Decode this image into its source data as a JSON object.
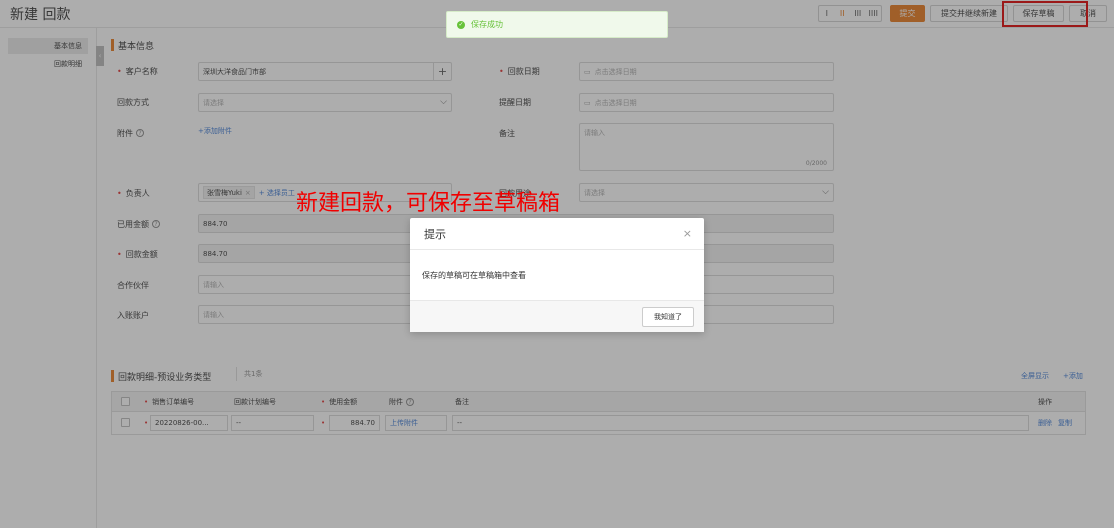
{
  "header": {
    "title": "新建 回款",
    "layout_options": [
      "I",
      "II",
      "III",
      "IIII"
    ],
    "buttons": {
      "submit": "提交",
      "submit_and_new": "提交并继续新建",
      "save_draft": "保存草稿",
      "cancel": "取消"
    }
  },
  "sidebar": {
    "items": [
      {
        "label": "基本信息",
        "active": true
      },
      {
        "label": "回款明细",
        "active": false
      }
    ],
    "collapse_glyph": "‹"
  },
  "basic_info": {
    "section_title": "基本信息",
    "customer": {
      "label": "客户名称",
      "value": "深圳大洋食品门市部",
      "add_glyph": "+"
    },
    "payment_date": {
      "label": "回款日期",
      "placeholder": "点击选择日期"
    },
    "payment_method": {
      "label": "回款方式",
      "placeholder": "请选择"
    },
    "remind_date": {
      "label": "提醒日期",
      "placeholder": "点击选择日期"
    },
    "attachment": {
      "label": "附件",
      "link": "+添加附件"
    },
    "remark": {
      "label": "备注",
      "placeholder": "请输入",
      "counter": "0/2000"
    },
    "owner": {
      "label": "负责人",
      "tag": "张雪梅Yuki",
      "tag_close": "×",
      "link": "+ 选择员工"
    },
    "purpose": {
      "label": "回款用途",
      "placeholder": "请选择"
    },
    "used_amount": {
      "label": "已用金额",
      "value": "884.70"
    },
    "payment_amount": {
      "label": "回款金额",
      "value": "884.70"
    },
    "partner": {
      "label": "合作伙伴",
      "placeholder": "请输入"
    },
    "account": {
      "label": "入账账户",
      "placeholder": "请输入"
    }
  },
  "detail": {
    "section_title": "回款明细-预设业务类型",
    "count": "共1条",
    "fullscreen": "全屏显示",
    "add": "+添加",
    "columns": [
      "销售订单编号",
      "回款计划编号",
      "使用金额",
      "附件",
      "备注",
      "操作"
    ],
    "rows": [
      {
        "order_no": "20220826-00...",
        "plan_no": "--",
        "amount": "884.70",
        "attachment": "上传附件",
        "remark": "--",
        "actions": [
          "删除",
          "复制"
        ]
      }
    ]
  },
  "toast": {
    "text": "保存成功"
  },
  "annotation": "新建回款，可保存至草稿箱",
  "modal": {
    "title": "提示",
    "message": "保存的草稿可在草稿箱中查看",
    "button": "我知道了",
    "close": "×"
  },
  "colors": {
    "accent": "#e8791d",
    "link": "#3a78d4",
    "annotation": "#f00000",
    "success": "#67c23a"
  }
}
